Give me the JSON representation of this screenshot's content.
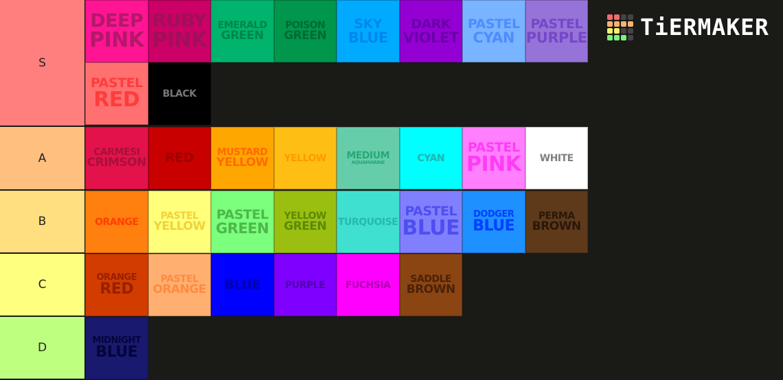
{
  "logo": {
    "text": "TiERMAKER",
    "grid": [
      "#f26b6b",
      "#f26b6b",
      "#444",
      "#444",
      "#f9b36e",
      "#f9b36e",
      "#f9b36e",
      "#f9b36e",
      "#f6f06b",
      "#f6f06b",
      "#444",
      "#444",
      "#7ef27a",
      "#7ef27a",
      "#7ef27a",
      "#444"
    ]
  },
  "tiers": [
    {
      "label": "S",
      "color": "#ff7f7f",
      "tiles": [
        {
          "line1": "DEEP",
          "line2": "PINK",
          "bg": "#ff1493",
          "fg": "#b3186a",
          "variant": "large"
        },
        {
          "line1": "RUBY",
          "line2": "PINK",
          "bg": "#cc0066",
          "fg": "#a0105a",
          "variant": "large"
        },
        {
          "line1": "EMERALD",
          "line2": "GREEN",
          "bg": "#00b46e",
          "fg": "#00854a",
          "variant": "small"
        },
        {
          "line1": "POISON",
          "line2": "GREEN",
          "bg": "#00964b",
          "fg": "#006a33",
          "variant": "small"
        },
        {
          "line1": "SKY",
          "line2": "BLUE",
          "bg": "#00aaff",
          "fg": "#0088ee",
          "variant": "med"
        },
        {
          "line1": "DARK",
          "line2": "VIOLET",
          "bg": "#9400d3",
          "fg": "#6a00a8",
          "variant": "med"
        },
        {
          "line1": "PASTEL",
          "line2": "CYAN",
          "bg": "#78b4ff",
          "fg": "#4f8cff",
          "variant": "med"
        },
        {
          "line1": "PASTEL",
          "line2": "PURPLE",
          "bg": "#9673d8",
          "fg": "#7448c8",
          "variant": "med"
        },
        {
          "line1": "PASTEL",
          "line2": "RED",
          "bg": "#ff7070",
          "fg": "#ff3c3c",
          "variant": "mix"
        },
        {
          "line1": "BLACK",
          "line2": "",
          "bg": "#000000",
          "fg": "#777777",
          "variant": "small"
        }
      ]
    },
    {
      "label": "A",
      "color": "#ffbf7f",
      "tiles": [
        {
          "line1": "CARMESI",
          "line2": "CRIMSON",
          "bg": "#e3124b",
          "fg": "#a8103c",
          "variant": "small"
        },
        {
          "line1": "RED",
          "line2": "",
          "bg": "#c80000",
          "fg": "#a00000",
          "variant": "med"
        },
        {
          "line1": "MUSTARD",
          "line2": "YELLOW",
          "bg": "#ffa600",
          "fg": "#ff6a00",
          "variant": "small"
        },
        {
          "line1": "YELLOW",
          "line2": "",
          "bg": "#ffbe14",
          "fg": "#ff9a00",
          "variant": "small"
        },
        {
          "line1": "MEDIUM",
          "line2": "AQUAMARINE",
          "bg": "#66cdaa",
          "fg": "#2aa878",
          "variant": "tiny"
        },
        {
          "line1": "CYAN",
          "line2": "",
          "bg": "#00ffff",
          "fg": "#1fb5b0",
          "variant": "small"
        },
        {
          "line1": "PASTEL",
          "line2": "PINK",
          "bg": "#ff7fff",
          "fg": "#ff3cf5",
          "variant": "mix"
        },
        {
          "line1": "WHITE",
          "line2": "",
          "bg": "#ffffff",
          "fg": "#808080",
          "variant": "small"
        }
      ]
    },
    {
      "label": "B",
      "color": "#ffdf7f",
      "tiles": [
        {
          "line1": "ORANGE",
          "line2": "",
          "bg": "#ff7f0f",
          "fg": "#ff4000",
          "variant": "small"
        },
        {
          "line1": "PASTEL",
          "line2": "YELLOW",
          "bg": "#ffff7a",
          "fg": "#f0d23a",
          "variant": "small"
        },
        {
          "line1": "PASTEL",
          "line2": "GREEN",
          "bg": "#7cff7c",
          "fg": "#4cb84c",
          "variant": "med"
        },
        {
          "line1": "YELLOW",
          "line2": "GREEN",
          "bg": "#9abf10",
          "fg": "#5c8a05",
          "variant": "small"
        },
        {
          "line1": "TURQUOISE",
          "line2": "",
          "bg": "#40e0d0",
          "fg": "#26b8b0",
          "variant": "small"
        },
        {
          "line1": "PASTEL",
          "line2": "BLUE",
          "bg": "#8080ff",
          "fg": "#4e4ef0",
          "variant": "mix"
        },
        {
          "line1": "DODGER",
          "line2": "BLUE",
          "bg": "#1e90ff",
          "fg": "#0040ff",
          "variant": "mix2"
        },
        {
          "line1": "PERMA",
          "line2": "BROWN",
          "bg": "#5e3a1b",
          "fg": "#2a180a",
          "variant": "small"
        }
      ]
    },
    {
      "label": "C",
      "color": "#ffff7f",
      "tiles": [
        {
          "line1": "ORANGE",
          "line2": "RED",
          "bg": "#d23c00",
          "fg": "#962000",
          "variant": "mix2"
        },
        {
          "line1": "PASTEL",
          "line2": "ORANGE",
          "bg": "#ffb070",
          "fg": "#ff8a40",
          "variant": "small"
        },
        {
          "line1": "BLUE",
          "line2": "",
          "bg": "#0000ff",
          "fg": "#0000b0",
          "variant": "med"
        },
        {
          "line1": "PURPLE",
          "line2": "",
          "bg": "#7f00ff",
          "fg": "#5000b0",
          "variant": "tiny"
        },
        {
          "line1": "FUCHSIA",
          "line2": "",
          "bg": "#ff00ff",
          "fg": "#b000b0",
          "variant": "small"
        },
        {
          "line1": "SADDLE",
          "line2": "BROWN",
          "bg": "#8b4513",
          "fg": "#4a2208",
          "variant": "small"
        }
      ]
    },
    {
      "label": "D",
      "color": "#bfff7f",
      "tiles": [
        {
          "line1": "MIDNIGHT",
          "line2": "BLUE",
          "bg": "#191970",
          "fg": "#05053a",
          "variant": "mix2"
        }
      ]
    }
  ]
}
